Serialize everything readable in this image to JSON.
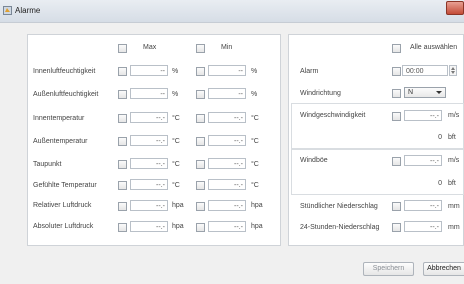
{
  "window": {
    "title": "Alarme"
  },
  "columns": {
    "max": "Max",
    "min": "Min",
    "select_all": "Alle auswählen"
  },
  "rows": [
    {
      "label": "Innenluftfeuchtigkeit",
      "max_value": "--",
      "max_unit": "%",
      "min_value": "--",
      "min_unit": "%"
    },
    {
      "label": "Außenluftfeuchtigkeit",
      "max_value": "--",
      "max_unit": "%",
      "min_value": "--",
      "min_unit": "%"
    },
    {
      "label": "Innentemperatur",
      "max_value": "--.-",
      "max_unit": "°C",
      "min_value": "--.-",
      "min_unit": "°C"
    },
    {
      "label": "Außentemperatur",
      "max_value": "--.-",
      "max_unit": "°C",
      "min_value": "--.-",
      "min_unit": "°C"
    },
    {
      "label": "Taupunkt",
      "max_value": "--.-",
      "max_unit": "°C",
      "min_value": "--.-",
      "min_unit": "°C"
    },
    {
      "label": "Gefühlte Temperatur",
      "max_value": "--.-",
      "max_unit": "°C",
      "min_value": "--.-",
      "min_unit": "°C"
    },
    {
      "label": "Relativer Luftdruck",
      "max_value": "--.-",
      "max_unit": "hpa",
      "min_value": "--.-",
      "min_unit": "hpa"
    },
    {
      "label": "Absoluter Luftdruck",
      "max_value": "--.-",
      "max_unit": "hpa",
      "min_value": "--.-",
      "min_unit": "hpa"
    }
  ],
  "right": {
    "alarm": {
      "label": "Alarm",
      "value": "00:00"
    },
    "wind_direction": {
      "label": "Windrichtung",
      "value": "N"
    },
    "wind_speed": {
      "label": "Windgeschwindigkeit",
      "value": "--.-",
      "unit": "m/s",
      "bft_value": "0",
      "bft_unit": "bft"
    },
    "gust": {
      "label": "Windböe",
      "value": "--.-",
      "unit": "m/s",
      "bft_value": "0",
      "bft_unit": "bft"
    },
    "hourly_rain": {
      "label": "Stündlicher Niederschlag",
      "value": "--.-",
      "unit": "mm"
    },
    "daily_rain": {
      "label": "24-Stunden-Niederschlag",
      "value": "--.-",
      "unit": "mm"
    }
  },
  "buttons": {
    "save": "Speichern",
    "cancel": "Abbrechen"
  }
}
